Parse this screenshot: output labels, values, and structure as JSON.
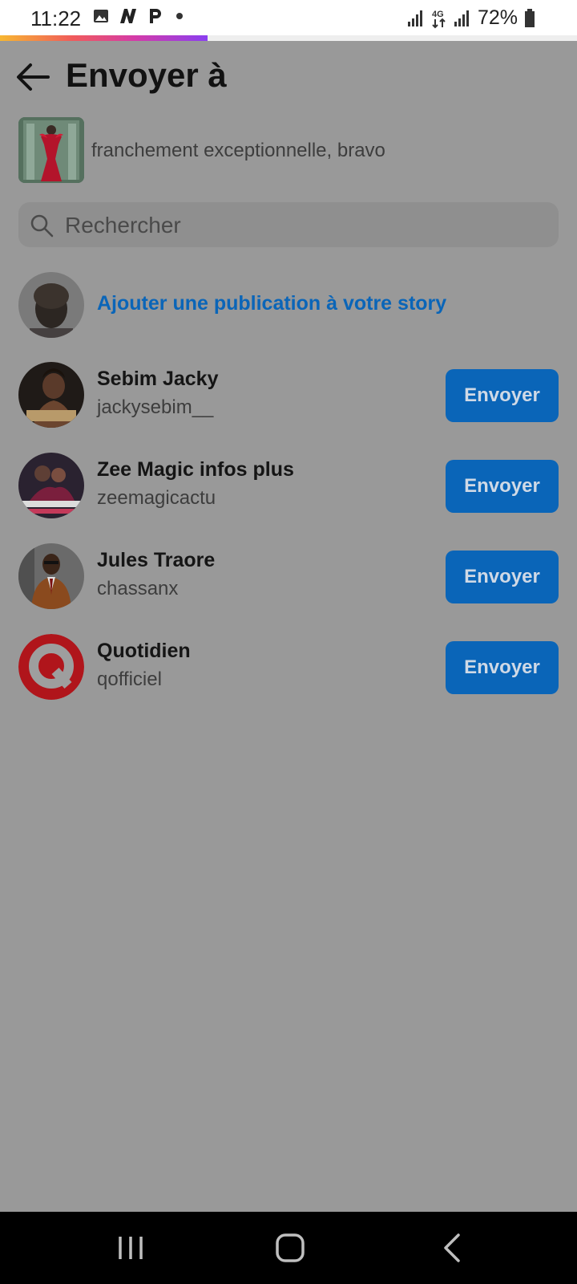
{
  "status_bar": {
    "time": "11:22",
    "left_icons": [
      "image-icon",
      "n-app-icon",
      "p-app-icon",
      "dot-icon"
    ],
    "network": "4G",
    "battery": "72%"
  },
  "progress": {
    "fraction": 0.36,
    "colors": [
      "#f7b731",
      "#f05b5b",
      "#d43ba8",
      "#8a3ff0"
    ]
  },
  "header": {
    "title": "Envoyer à"
  },
  "post": {
    "caption": "franchement exceptionnelle, bravo"
  },
  "search": {
    "placeholder": "Rechercher",
    "value": ""
  },
  "story": {
    "label": "Ajouter une publication à votre story"
  },
  "contacts": [
    {
      "name": "Sebim Jacky",
      "handle": "jackysebim__",
      "button": "Envoyer"
    },
    {
      "name": "Zee Magic infos plus",
      "handle": "zeemagicactu",
      "button": "Envoyer"
    },
    {
      "name": "Jules Traore",
      "handle": "chassanx",
      "button": "Envoyer"
    },
    {
      "name": "Quotidien",
      "handle": "qofficiel",
      "button": "Envoyer"
    }
  ],
  "colors": {
    "accent": "#0a65b8",
    "overlay": "#999999"
  }
}
